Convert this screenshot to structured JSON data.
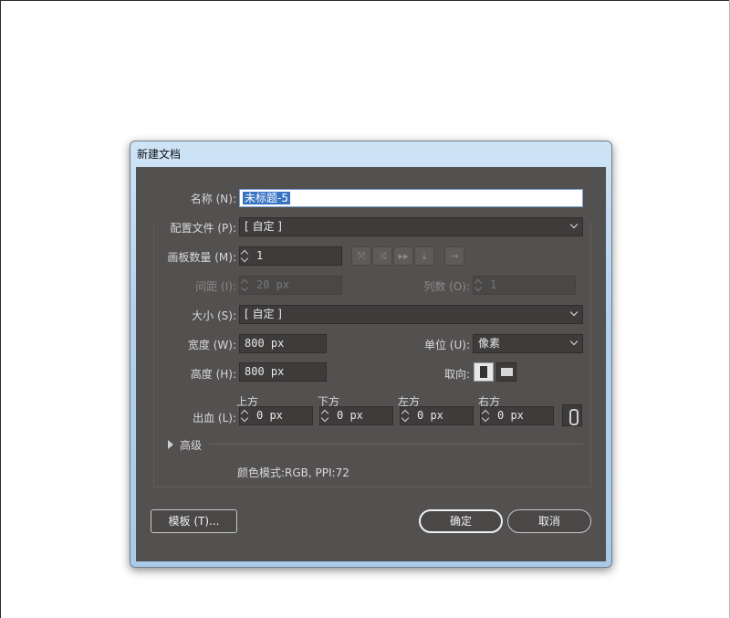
{
  "dialog": {
    "title": "新建文档",
    "name_label": "名称 (N):",
    "name_value": "未标题-5",
    "profile_label": "配置文件 (P):",
    "profile_value": "[ 自定 ]",
    "artboards_label": "画板数量 (M):",
    "artboards_value": "1",
    "arrange_icons": [
      "grid-by-row-icon",
      "grid-by-column-icon",
      "arrange-by-row-icon",
      "arrange-by-column-icon",
      "right-to-left-icon"
    ],
    "spacing_label": "间距 (I):",
    "spacing_value": "20 px",
    "columns_label": "列数 (O):",
    "columns_value": "1",
    "size_label": "大小 (S):",
    "size_value": "[ 自定 ]",
    "width_label": "宽度 (W):",
    "width_value": "800 px",
    "units_label": "单位 (U):",
    "units_value": "像素",
    "height_label": "高度 (H):",
    "height_value": "800 px",
    "orientation_label": "取向:",
    "bleed_label": "出血 (L):",
    "bleed": [
      {
        "label": "上方",
        "value": "0 px"
      },
      {
        "label": "下方",
        "value": "0 px"
      },
      {
        "label": "左方",
        "value": "0 px"
      },
      {
        "label": "右方",
        "value": "0 px"
      }
    ],
    "advanced_label": "高级",
    "color_mode_text": "颜色模式:RGB, PPI:72",
    "template_button": "模板 (T)...",
    "ok_button": "确定",
    "cancel_button": "取消"
  }
}
